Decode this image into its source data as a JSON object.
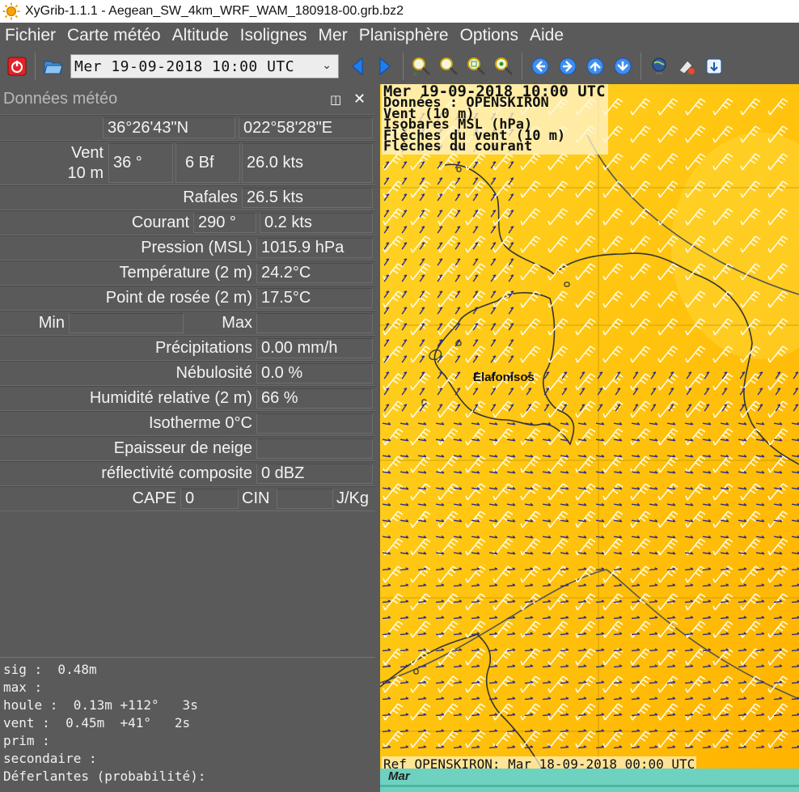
{
  "window": {
    "title": "XyGrib-1.1.1 - Aegean_SW_4km_WRF_WAM_180918-00.grb.bz2"
  },
  "menubar": {
    "items": [
      "Fichier",
      "Carte météo",
      "Altitude",
      "Isolignes",
      "Mer",
      "Planisphère",
      "Options",
      "Aide"
    ]
  },
  "toolbar": {
    "date_value": "Mer 19-09-2018 10:00 UTC",
    "icons": [
      "power-icon",
      "open-folder-icon",
      "prev-step-icon",
      "next-step-icon",
      "zoom-in-icon",
      "zoom-out-icon",
      "zoom-fit-icon",
      "zoom-all-icon",
      "pan-left-icon",
      "pan-right-icon",
      "pan-up-icon",
      "pan-down-icon",
      "globe-icon",
      "select-zone-icon",
      "export-icon"
    ]
  },
  "panel": {
    "title": "Données météo",
    "coords": {
      "lat": "36°26'43\"N",
      "lon": "022°58'28\"E"
    },
    "vent": {
      "label_line1": "Vent",
      "label_line2": "10 m",
      "direction": "36 °",
      "beaufort": "6 Bf",
      "speed": "26.0  kts"
    },
    "rafales": {
      "label": "Rafales",
      "value": "26.5  kts"
    },
    "courant": {
      "label": "Courant",
      "direction": "290 °",
      "speed": "0.2  kts"
    },
    "pression": {
      "label": "Pression (MSL)",
      "value": "1015.9 hPa"
    },
    "temperature": {
      "label": "Température (2 m)",
      "value": "24.2°C"
    },
    "rosee": {
      "label": "Point de rosée (2 m)",
      "value": "17.5°C"
    },
    "minmax": {
      "min_label": "Min",
      "max_label": "Max"
    },
    "precip": {
      "label": "Précipitations",
      "value": "0.00 mm/h"
    },
    "nebulosite": {
      "label": "Nébulosité",
      "value": "0.0 %"
    },
    "humidite": {
      "label": "Humidité relative (2 m)",
      "value": "66 %"
    },
    "isotherme": {
      "label": "Isotherme 0°C",
      "value": ""
    },
    "neige": {
      "label": "Epaisseur de neige",
      "value": ""
    },
    "reflectivite": {
      "label": "réflectivité composite",
      "value": "0 dBZ"
    },
    "cape": {
      "label": "CAPE",
      "value": "0",
      "cin_label": "CIN",
      "cin_value": "",
      "unit": "J/Kg"
    }
  },
  "seastate": {
    "lines": [
      "sig :  0.48m",
      "max :",
      "houle :  0.13m +112°   3s",
      "vent :  0.45m  +41°   2s",
      "prim :",
      "secondaire :",
      "Déferlantes (probabilité):"
    ]
  },
  "map": {
    "overlay_lines": [
      "Mer 19-09-2018 10:00 UTC",
      "Données : OPENSKIRON",
      "Vent (10 m)",
      "Isobares MSL (hPa)",
      "Flèches du vent (10 m)",
      "Flèches du courant"
    ],
    "place_label": "Elafonisos",
    "ref_text": "Ref OPENSKIRON: Mar 18-09-2018 00:00 UTC",
    "timeline_day": "Mar",
    "colors": {
      "field_light": "#ffd52a",
      "field_dark": "#ffb300",
      "barb": "#fffbe6",
      "current_arrow": "#2b2b8a",
      "coast": "#333333",
      "isobar": "#555555"
    }
  }
}
